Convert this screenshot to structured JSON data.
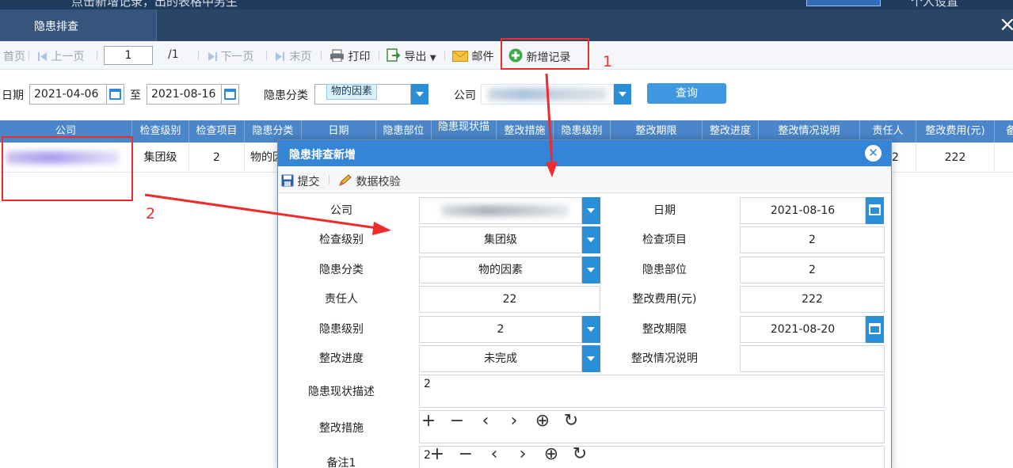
{
  "top_strip": {
    "ghost_text": "点击新增记录，出的表格中另生",
    "ghost_right": "个人设置"
  },
  "titlebar": {
    "tab_label": "隐患排查",
    "close_glyph": "×"
  },
  "toolbar": {
    "first_page": "首页",
    "prev_page": "上一页",
    "page_value": "1",
    "page_total": "/1",
    "next_page": "下一页",
    "last_page": "末页",
    "print": "打印",
    "export": "导出",
    "mail": "邮件",
    "add_record": "新增记录"
  },
  "annotations": {
    "label_1": "1",
    "label_2": "2"
  },
  "filters": {
    "date_label": "日期",
    "date_from": "2021-04-06",
    "to_label": "至",
    "date_to": "2021-08-16",
    "category_label": "隐患分类",
    "category_chip": "物的因素",
    "company_label": "公司",
    "query_button": "查询"
  },
  "grid": {
    "columns": [
      "公司",
      "检查级别",
      "检查项目",
      "隐患分类",
      "日期",
      "隐患部位",
      "隐患现状描",
      "整改措施",
      "隐患级别",
      "整改期限",
      "整改进度",
      "整改情况说明",
      "责任人",
      "整改费用(元)",
      "备"
    ],
    "row": {
      "level": "集团级",
      "item": "2",
      "category": "物的因",
      "owner_tail": "2",
      "cost": "222"
    }
  },
  "dialog": {
    "title": "隐患排查新增",
    "close_glyph": "✕",
    "submit": "提交",
    "validate": "数据校验",
    "fields": {
      "company_label": "公司",
      "date_label": "日期",
      "date_value": "2021-08-16",
      "level_label": "检查级别",
      "level_value": "集团级",
      "item_label": "检查项目",
      "item_value": "2",
      "category_label": "隐患分类",
      "category_value": "物的因素",
      "location_label": "隐患部位",
      "location_value": "2",
      "owner_label": "责任人",
      "owner_value": "22",
      "cost_label": "整改费用(元)",
      "cost_value": "222",
      "hazard_level_label": "隐患级别",
      "hazard_level_value": "2",
      "deadline_label": "整改期限",
      "deadline_value": "2021-08-20",
      "progress_label": "整改进度",
      "progress_value": "未完成",
      "progress_note_label": "整改情况说明",
      "progress_note_value": "",
      "description_label": "隐患现状描述",
      "description_value": "2",
      "measures_label": "整改措施",
      "remark_label": "备注1",
      "remark_value": "2"
    },
    "image_controls": [
      "+",
      "−",
      "‹",
      "›",
      "⊕",
      "↻"
    ]
  },
  "colors": {
    "accent_blue": "#3484d8",
    "grid_header": "#4a86c9",
    "titlebar": "#2a4566",
    "annotation_red": "#ef2b2b",
    "add_icon_green": "#3aab46"
  }
}
